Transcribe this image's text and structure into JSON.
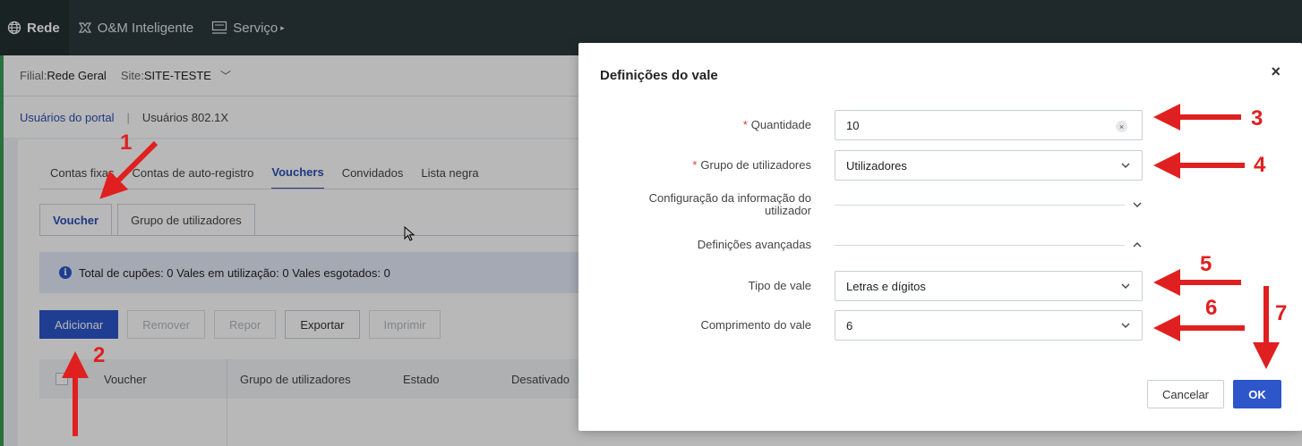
{
  "topnav": {
    "items": [
      {
        "label": "Rede",
        "icon": "globe-icon"
      },
      {
        "label": "O&M Inteligente",
        "icon": "maintenance-icon"
      },
      {
        "label": "Serviço",
        "icon": "service-icon"
      }
    ]
  },
  "sitebar": {
    "branch_label": "Filial:",
    "branch_value": "Rede Geral",
    "site_label": "Site:",
    "site_value": "SITE-TESTE"
  },
  "user_tabs": {
    "portal": "Usuários do portal",
    "sep": "|",
    "dot1x": "Usuários 802.1X"
  },
  "subtabs": [
    {
      "label": "Contas fixas"
    },
    {
      "label": "Contas de auto-registro"
    },
    {
      "label": "Vouchers"
    },
    {
      "label": "Convidados"
    },
    {
      "label": "Lista negra"
    }
  ],
  "cardtabs": [
    {
      "label": "Voucher"
    },
    {
      "label": "Grupo de utilizadores"
    }
  ],
  "infobar": {
    "text": "Total de cupões: 0  Vales em utilização: 0  Vales esgotados: 0"
  },
  "toolbar": {
    "add": "Adicionar",
    "remove": "Remover",
    "reset": "Repor",
    "export": "Exportar",
    "print": "Imprimir"
  },
  "table": {
    "headers": [
      "Voucher",
      "Grupo de utilizadores",
      "Estado",
      "Desativado"
    ]
  },
  "modal": {
    "title": "Definições do vale",
    "close": "×",
    "fields": {
      "quantity_label": "Quantidade",
      "quantity_value": "10",
      "group_label": "Grupo de utilizadores",
      "group_value": "Utilizadores",
      "userinfo_label": "Configuração da informação do utilizador",
      "advanced_label": "Definições avançadas",
      "type_label": "Tipo de vale",
      "type_value": "Letras e dígitos",
      "length_label": "Comprimento do vale",
      "length_value": "6"
    },
    "cancel": "Cancelar",
    "ok": "OK"
  },
  "annotations": [
    "1",
    "2",
    "3",
    "4",
    "5",
    "6",
    "7"
  ],
  "colors": {
    "nav_bg": "#2b3a3c",
    "primary": "#2c56c9",
    "annotation": "#e02020",
    "required": "#e03b3b"
  }
}
